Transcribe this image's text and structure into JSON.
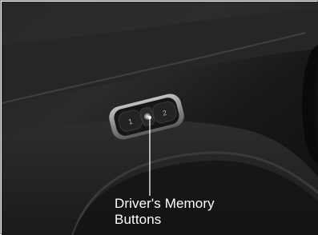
{
  "photo": {
    "subject": "door-panel-memory-seat-buttons",
    "colors": {
      "frame": "#8a8a8a",
      "panel_dark": "#151515",
      "panel_mid": "#2a2a2a",
      "bezel": "#9a9a9a",
      "button": "#1f1f1f",
      "button_glyph": "#b8b8b8",
      "callout_line": "#ffffff",
      "caption_text": "#ffffff"
    },
    "buttons": [
      {
        "glyph": "1"
      },
      {
        "glyph": "·"
      },
      {
        "glyph": "2"
      }
    ]
  },
  "caption": {
    "line1": "Driver's Memory",
    "line2": "Buttons"
  }
}
